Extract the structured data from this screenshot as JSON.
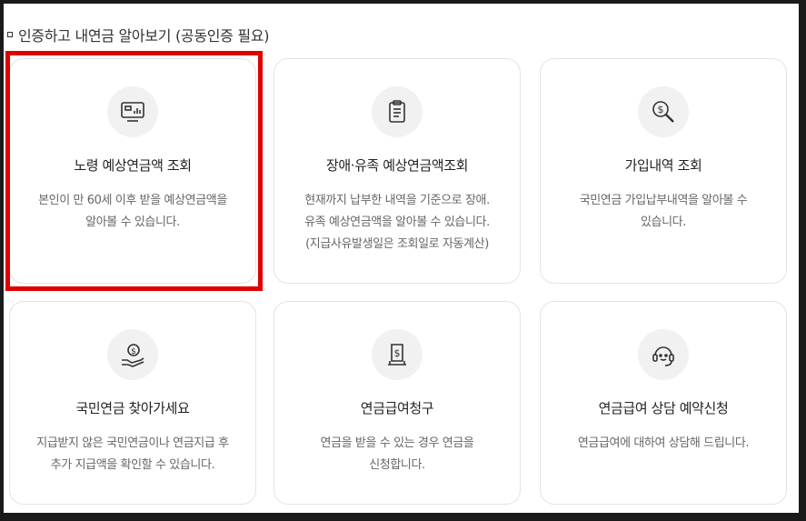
{
  "section": {
    "title": "인증하고 내연금 알아보기 (공동인증 필요)"
  },
  "cards": [
    {
      "icon": "monitor-chart-icon",
      "title": "노령 예상연금액 조회",
      "desc": "본인이 만 60세 이후 받을 예상연금액을\n알아볼 수 있습니다."
    },
    {
      "icon": "clipboard-list-icon",
      "title": "장애·유족 예상연금액조회",
      "desc": "현재까지 납부한 내역을 기준으로 장애.\n유족 예상연금액을 알아볼 수 있습니다.\n(지급사유발생일은 조회일로 자동계산)"
    },
    {
      "icon": "dollar-search-icon",
      "title": "가입내역 조회",
      "desc": "국민연금 가입납부내역을 알아볼 수\n있습니다."
    },
    {
      "icon": "hand-coin-icon",
      "title": "국민연금 찾아가세요",
      "desc": "지급받지 않은 국민연금이나 연금지급 후\n추가 지급액을 확인할 수 있습니다."
    },
    {
      "icon": "dollar-document-icon",
      "title": "연금급여청구",
      "desc": "연금을 받을 수 있는 경우 연금을\n신청합니다."
    },
    {
      "icon": "headset-icon",
      "title": "연금급여 상담 예약신청",
      "desc": "연금급여에 대하여 상담해 드립니다."
    }
  ],
  "colors": {
    "highlight": "#e00000",
    "card_border": "#e3e3e3",
    "icon_bg": "#f1f1f1"
  }
}
